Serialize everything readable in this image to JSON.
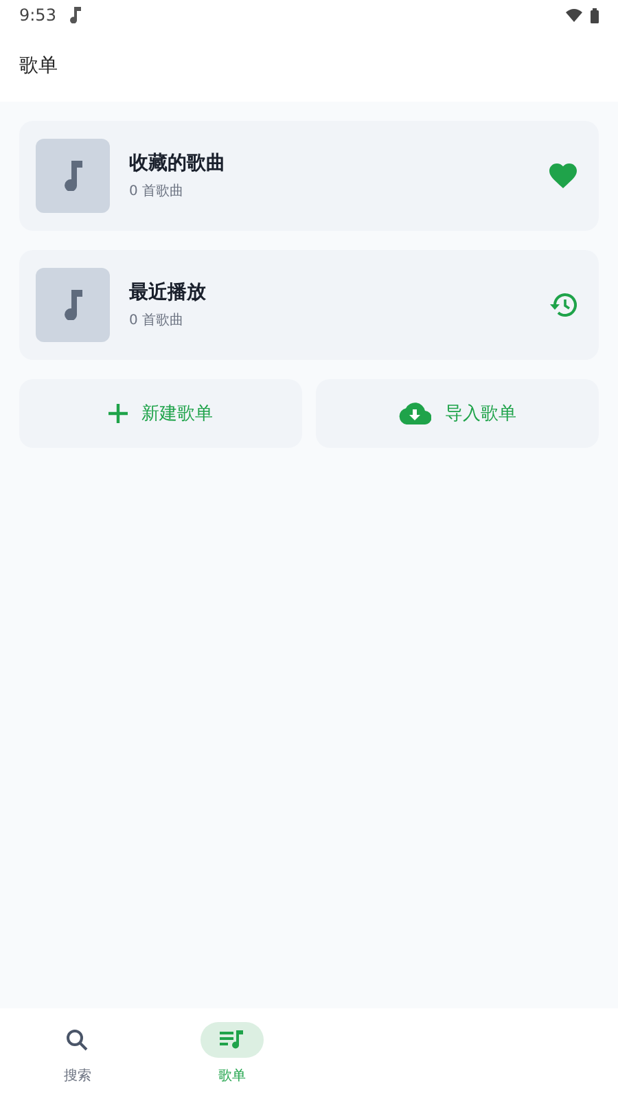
{
  "status_bar": {
    "time": "9:53"
  },
  "header": {
    "title": "歌单"
  },
  "playlists": [
    {
      "title": "收藏的歌曲",
      "count": "0 首歌曲",
      "kind": "favorite"
    },
    {
      "title": "最近播放",
      "count": "0 首歌曲",
      "kind": "history"
    }
  ],
  "actions": [
    {
      "label": "新建歌单",
      "kind": "create"
    },
    {
      "label": "导入歌单",
      "kind": "import"
    }
  ],
  "bottom_nav": [
    {
      "label": "搜索",
      "kind": "search",
      "selected": false
    },
    {
      "label": "歌单",
      "kind": "playlist",
      "selected": true
    }
  ]
}
